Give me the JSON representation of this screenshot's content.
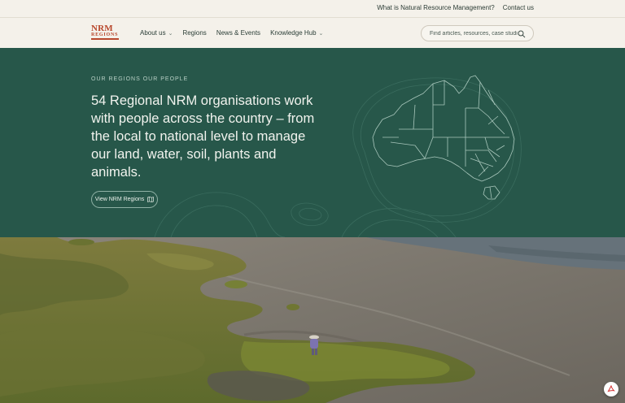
{
  "utility": {
    "links": [
      "What is Natural Resource Management?",
      "Contact us"
    ]
  },
  "logo": {
    "line1": "NRM",
    "line2": "REGIONS"
  },
  "nav": {
    "items": [
      {
        "label": "About us",
        "dropdown": true
      },
      {
        "label": "Regions",
        "dropdown": false
      },
      {
        "label": "News & Events",
        "dropdown": false
      },
      {
        "label": "Knowledge Hub",
        "dropdown": true
      }
    ]
  },
  "search": {
    "placeholder": "Find articles, resources, case studies..."
  },
  "hero": {
    "eyebrow": "OUR REGIONS OUR PEOPLE",
    "headline": "54 Regional NRM organisations work with people across the country – from the local to national level to manage our land, water, soil, plants and animals.",
    "button_label": "View NRM Regions"
  },
  "colors": {
    "hero_bg": "#27574a",
    "brand_rust": "#b8472c",
    "page_bg": "#f4f1ea"
  },
  "icons": {
    "search": "search-icon",
    "map": "map-icon",
    "pdf": "pdf-icon",
    "chevron": "chevron-down-icon"
  }
}
